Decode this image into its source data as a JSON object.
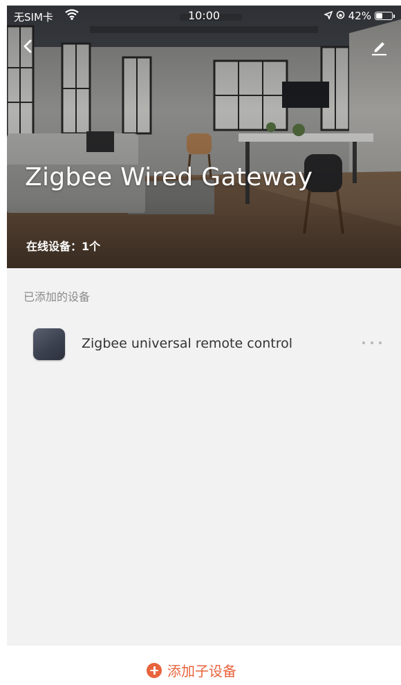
{
  "status_bar": {
    "carrier": "无SIM卡",
    "time": "10:00",
    "battery_text": "42%",
    "battery_level": 0.42
  },
  "header": {
    "back_icon": "chevron-left-icon",
    "edit_icon": "pencil-icon",
    "title": "Zigbee Wired Gateway",
    "online_devices": "在线设备：1个"
  },
  "devices": {
    "section_label": "已添加的设备",
    "items": [
      {
        "name": "Zigbee universal remote control",
        "more_icon": "ellipsis-icon"
      }
    ]
  },
  "footer": {
    "add_label": "添加子设备",
    "add_icon": "plus-circle-icon"
  },
  "colors": {
    "accent": "#e8643c",
    "background": "#f2f2f2"
  }
}
